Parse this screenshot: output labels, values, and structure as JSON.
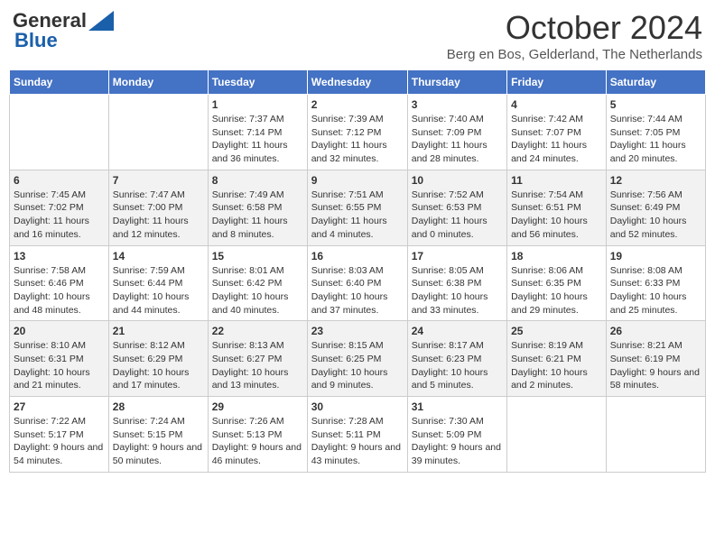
{
  "header": {
    "logo_general": "General",
    "logo_blue": "Blue",
    "month_title": "October 2024",
    "subtitle": "Berg en Bos, Gelderland, The Netherlands"
  },
  "days_of_week": [
    "Sunday",
    "Monday",
    "Tuesday",
    "Wednesday",
    "Thursday",
    "Friday",
    "Saturday"
  ],
  "weeks": [
    [
      {
        "day": "",
        "sunrise": "",
        "sunset": "",
        "daylight": ""
      },
      {
        "day": "",
        "sunrise": "",
        "sunset": "",
        "daylight": ""
      },
      {
        "day": "1",
        "sunrise": "Sunrise: 7:37 AM",
        "sunset": "Sunset: 7:14 PM",
        "daylight": "Daylight: 11 hours and 36 minutes."
      },
      {
        "day": "2",
        "sunrise": "Sunrise: 7:39 AM",
        "sunset": "Sunset: 7:12 PM",
        "daylight": "Daylight: 11 hours and 32 minutes."
      },
      {
        "day": "3",
        "sunrise": "Sunrise: 7:40 AM",
        "sunset": "Sunset: 7:09 PM",
        "daylight": "Daylight: 11 hours and 28 minutes."
      },
      {
        "day": "4",
        "sunrise": "Sunrise: 7:42 AM",
        "sunset": "Sunset: 7:07 PM",
        "daylight": "Daylight: 11 hours and 24 minutes."
      },
      {
        "day": "5",
        "sunrise": "Sunrise: 7:44 AM",
        "sunset": "Sunset: 7:05 PM",
        "daylight": "Daylight: 11 hours and 20 minutes."
      }
    ],
    [
      {
        "day": "6",
        "sunrise": "Sunrise: 7:45 AM",
        "sunset": "Sunset: 7:02 PM",
        "daylight": "Daylight: 11 hours and 16 minutes."
      },
      {
        "day": "7",
        "sunrise": "Sunrise: 7:47 AM",
        "sunset": "Sunset: 7:00 PM",
        "daylight": "Daylight: 11 hours and 12 minutes."
      },
      {
        "day": "8",
        "sunrise": "Sunrise: 7:49 AM",
        "sunset": "Sunset: 6:58 PM",
        "daylight": "Daylight: 11 hours and 8 minutes."
      },
      {
        "day": "9",
        "sunrise": "Sunrise: 7:51 AM",
        "sunset": "Sunset: 6:55 PM",
        "daylight": "Daylight: 11 hours and 4 minutes."
      },
      {
        "day": "10",
        "sunrise": "Sunrise: 7:52 AM",
        "sunset": "Sunset: 6:53 PM",
        "daylight": "Daylight: 11 hours and 0 minutes."
      },
      {
        "day": "11",
        "sunrise": "Sunrise: 7:54 AM",
        "sunset": "Sunset: 6:51 PM",
        "daylight": "Daylight: 10 hours and 56 minutes."
      },
      {
        "day": "12",
        "sunrise": "Sunrise: 7:56 AM",
        "sunset": "Sunset: 6:49 PM",
        "daylight": "Daylight: 10 hours and 52 minutes."
      }
    ],
    [
      {
        "day": "13",
        "sunrise": "Sunrise: 7:58 AM",
        "sunset": "Sunset: 6:46 PM",
        "daylight": "Daylight: 10 hours and 48 minutes."
      },
      {
        "day": "14",
        "sunrise": "Sunrise: 7:59 AM",
        "sunset": "Sunset: 6:44 PM",
        "daylight": "Daylight: 10 hours and 44 minutes."
      },
      {
        "day": "15",
        "sunrise": "Sunrise: 8:01 AM",
        "sunset": "Sunset: 6:42 PM",
        "daylight": "Daylight: 10 hours and 40 minutes."
      },
      {
        "day": "16",
        "sunrise": "Sunrise: 8:03 AM",
        "sunset": "Sunset: 6:40 PM",
        "daylight": "Daylight: 10 hours and 37 minutes."
      },
      {
        "day": "17",
        "sunrise": "Sunrise: 8:05 AM",
        "sunset": "Sunset: 6:38 PM",
        "daylight": "Daylight: 10 hours and 33 minutes."
      },
      {
        "day": "18",
        "sunrise": "Sunrise: 8:06 AM",
        "sunset": "Sunset: 6:35 PM",
        "daylight": "Daylight: 10 hours and 29 minutes."
      },
      {
        "day": "19",
        "sunrise": "Sunrise: 8:08 AM",
        "sunset": "Sunset: 6:33 PM",
        "daylight": "Daylight: 10 hours and 25 minutes."
      }
    ],
    [
      {
        "day": "20",
        "sunrise": "Sunrise: 8:10 AM",
        "sunset": "Sunset: 6:31 PM",
        "daylight": "Daylight: 10 hours and 21 minutes."
      },
      {
        "day": "21",
        "sunrise": "Sunrise: 8:12 AM",
        "sunset": "Sunset: 6:29 PM",
        "daylight": "Daylight: 10 hours and 17 minutes."
      },
      {
        "day": "22",
        "sunrise": "Sunrise: 8:13 AM",
        "sunset": "Sunset: 6:27 PM",
        "daylight": "Daylight: 10 hours and 13 minutes."
      },
      {
        "day": "23",
        "sunrise": "Sunrise: 8:15 AM",
        "sunset": "Sunset: 6:25 PM",
        "daylight": "Daylight: 10 hours and 9 minutes."
      },
      {
        "day": "24",
        "sunrise": "Sunrise: 8:17 AM",
        "sunset": "Sunset: 6:23 PM",
        "daylight": "Daylight: 10 hours and 5 minutes."
      },
      {
        "day": "25",
        "sunrise": "Sunrise: 8:19 AM",
        "sunset": "Sunset: 6:21 PM",
        "daylight": "Daylight: 10 hours and 2 minutes."
      },
      {
        "day": "26",
        "sunrise": "Sunrise: 8:21 AM",
        "sunset": "Sunset: 6:19 PM",
        "daylight": "Daylight: 9 hours and 58 minutes."
      }
    ],
    [
      {
        "day": "27",
        "sunrise": "Sunrise: 7:22 AM",
        "sunset": "Sunset: 5:17 PM",
        "daylight": "Daylight: 9 hours and 54 minutes."
      },
      {
        "day": "28",
        "sunrise": "Sunrise: 7:24 AM",
        "sunset": "Sunset: 5:15 PM",
        "daylight": "Daylight: 9 hours and 50 minutes."
      },
      {
        "day": "29",
        "sunrise": "Sunrise: 7:26 AM",
        "sunset": "Sunset: 5:13 PM",
        "daylight": "Daylight: 9 hours and 46 minutes."
      },
      {
        "day": "30",
        "sunrise": "Sunrise: 7:28 AM",
        "sunset": "Sunset: 5:11 PM",
        "daylight": "Daylight: 9 hours and 43 minutes."
      },
      {
        "day": "31",
        "sunrise": "Sunrise: 7:30 AM",
        "sunset": "Sunset: 5:09 PM",
        "daylight": "Daylight: 9 hours and 39 minutes."
      },
      {
        "day": "",
        "sunrise": "",
        "sunset": "",
        "daylight": ""
      },
      {
        "day": "",
        "sunrise": "",
        "sunset": "",
        "daylight": ""
      }
    ]
  ]
}
